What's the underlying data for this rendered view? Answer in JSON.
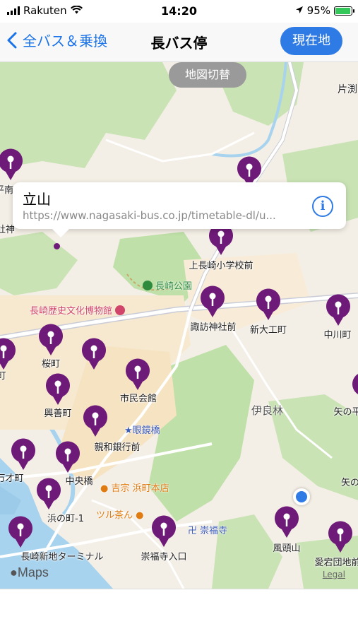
{
  "status": {
    "carrier": "Rakuten",
    "time": "14:20",
    "battery": "95%",
    "battery_level": 0.95
  },
  "nav": {
    "back_label": "全バス＆乗換",
    "title": "長バス停",
    "current_location_label": "現在地"
  },
  "map": {
    "toggle_label": "地図切替",
    "callout": {
      "title": "立山",
      "url": "https://www.nagasaki-bus.co.jp/timetable-dl/u..."
    },
    "bus_stop_labels": [
      "上長崎小学校前",
      "諏訪神社前",
      "新大工町",
      "中川町",
      "桜町",
      "市民会館",
      "興善町",
      "親和銀行前",
      "中央橋",
      "浜の町-1",
      "長崎新地ターミナル",
      "崇福寺入口",
      "風頭山",
      "愛宕団地前"
    ],
    "partial_labels": {
      "edge_left_1": "平南",
      "edge_left_2": "社神",
      "edge_left_3": "町",
      "edge_left_4": "万才町",
      "edge_right_1": "片渕",
      "edge_right_2": "矢の平",
      "edge_right_3": "矢の"
    },
    "landmarks": {
      "park": "長崎公園",
      "museum": "長崎歴史文化博物館",
      "bridge": "眼鏡橋",
      "restaurant1": "吉宗 浜町本店",
      "restaurant2": "ツル茶ん",
      "temple": "崇福寺",
      "area": "伊良林"
    },
    "maps_logo": "Maps",
    "legal": "Legal"
  },
  "colors": {
    "pin": "#6e1a78",
    "accent": "#2f7be5"
  }
}
